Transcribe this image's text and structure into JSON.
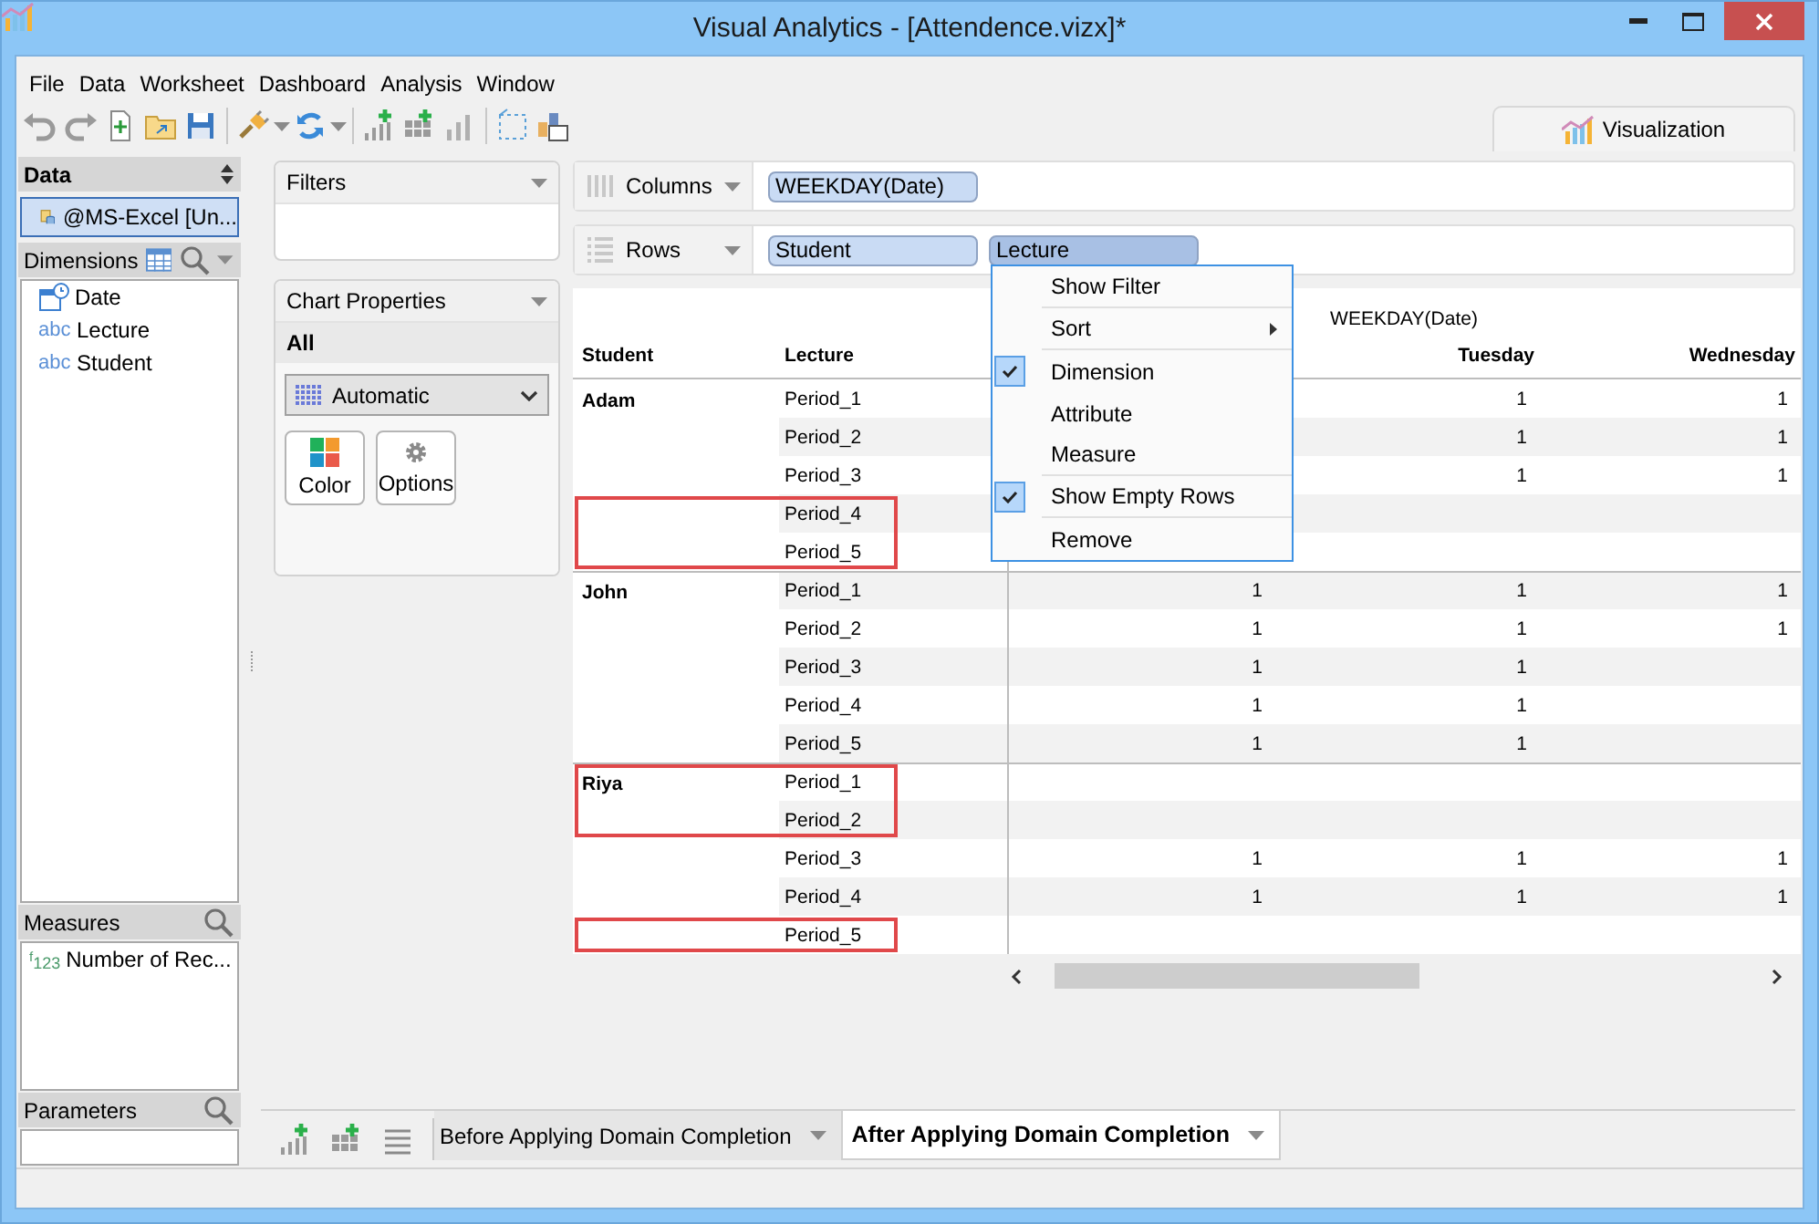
{
  "window": {
    "title": "Visual Analytics - [Attendence.vizx]*"
  },
  "menu": [
    "File",
    "Data",
    "Worksheet",
    "Dashboard",
    "Analysis",
    "Window"
  ],
  "view_tab": {
    "label": "Visualization"
  },
  "data_panel": {
    "title": "Data",
    "sources": [
      {
        "label": "@MS-Excel [Un...",
        "selected": true
      }
    ]
  },
  "dimensions": {
    "title": "Dimensions",
    "items": [
      {
        "label": "Date",
        "kind": "date"
      },
      {
        "label": "Lecture",
        "kind": "text",
        "badge": "abc"
      },
      {
        "label": "Student",
        "kind": "text",
        "badge": "abc"
      }
    ]
  },
  "measures": {
    "title": "Measures",
    "items": [
      {
        "label": "Number of Rec...",
        "kind": "number",
        "badge": "$^{f}$123"
      }
    ]
  },
  "parameters": {
    "title": "Parameters"
  },
  "filters": {
    "title": "Filters"
  },
  "chart_properties": {
    "title": "Chart Properties",
    "scope": "All",
    "chart_type": "Automatic",
    "buttons": [
      {
        "label": "Color",
        "kind": "color"
      },
      {
        "label": "Options",
        "kind": "options"
      }
    ]
  },
  "shelves": [
    {
      "label": "Columns",
      "kind": "columns",
      "pills": [
        {
          "label": "WEEKDAY(Date)",
          "selected": false
        }
      ]
    },
    {
      "label": "Rows",
      "kind": "rows",
      "pills": [
        {
          "label": "Student",
          "selected": false
        },
        {
          "label": "Lecture",
          "selected": true
        }
      ]
    }
  ],
  "table": {
    "column_group": "WEEKDAY(Date)",
    "headers": {
      "student": "Student",
      "lecture": "Lecture",
      "column_4": "Tuesday",
      "column_5": "Wednesday"
    },
    "groups": [
      {
        "student": "Adam",
        "rows": [
          {
            "lecture": "Period_1",
            "column_4": "1",
            "column_5": "1",
            "highlighted": false
          },
          {
            "lecture": "Period_2",
            "column_4": "1",
            "column_5": "1",
            "highlighted": false
          },
          {
            "lecture": "Period_3",
            "column_4": "1",
            "column_5": "1",
            "highlighted": false
          },
          {
            "lecture": "Period_4",
            "highlighted": true
          },
          {
            "lecture": "Period_5",
            "highlighted": true
          }
        ]
      },
      {
        "student": "John",
        "rows": [
          {
            "lecture": "Period_1",
            "column_3": "1",
            "column_4": "1",
            "column_5": "1",
            "highlighted": false
          },
          {
            "lecture": "Period_2",
            "column_3": "1",
            "column_4": "1",
            "column_5": "1",
            "highlighted": false
          },
          {
            "lecture": "Period_3",
            "column_3": "1",
            "column_4": "1",
            "highlighted": false
          },
          {
            "lecture": "Period_4",
            "column_3": "1",
            "column_4": "1",
            "highlighted": false
          },
          {
            "lecture": "Period_5",
            "column_3": "1",
            "column_4": "1",
            "highlighted": false
          }
        ]
      },
      {
        "student": "Riya",
        "rows": [
          {
            "lecture": "Period_1",
            "highlighted": true
          },
          {
            "lecture": "Period_2",
            "highlighted": true
          },
          {
            "lecture": "Period_3",
            "column_3": "1",
            "column_4": "1",
            "column_5": "1",
            "highlighted": false
          },
          {
            "lecture": "Period_4",
            "column_3": "1",
            "column_4": "1",
            "column_5": "1",
            "highlighted": false
          },
          {
            "lecture": "Period_5",
            "highlighted": true
          }
        ]
      }
    ]
  },
  "context_menu": {
    "items": [
      {
        "label": "Show Filter",
        "checked": false,
        "submenu": false,
        "separator_after": true
      },
      {
        "label": "Sort",
        "checked": false,
        "submenu": true,
        "separator_after": true
      },
      {
        "label": "Dimension",
        "checked": true,
        "submenu": false,
        "separator_after": false
      },
      {
        "label": "Attribute",
        "checked": false,
        "submenu": false,
        "separator_after": false
      },
      {
        "label": "Measure",
        "checked": false,
        "submenu": false,
        "separator_after": true
      },
      {
        "label": "Show Empty Rows",
        "checked": true,
        "submenu": false,
        "separator_after": true
      },
      {
        "label": "Remove",
        "checked": false,
        "submenu": false,
        "separator_after": false
      }
    ]
  },
  "sheet_tabs": [
    {
      "label": "Before Applying Domain Completion",
      "selected": false
    },
    {
      "label": "After Applying Domain Completion",
      "selected": true
    }
  ]
}
